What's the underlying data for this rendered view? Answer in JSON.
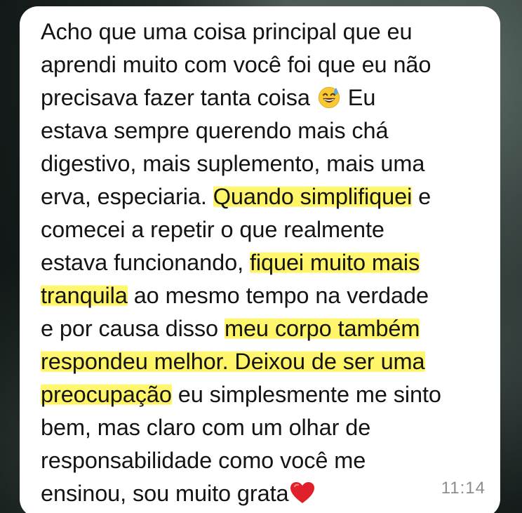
{
  "message": {
    "lines": [
      [
        {
          "text": "Acho que uma coisa principal que eu"
        }
      ],
      [
        {
          "text": "aprendi muito com você foi que eu não"
        }
      ],
      [
        {
          "text": "precisava fazer tanta coisa "
        },
        {
          "emoji": "grinning-sweat-emoji"
        },
        {
          "text": " Eu"
        }
      ],
      [
        {
          "text": "estava sempre querendo mais chá"
        }
      ],
      [
        {
          "text": "digestivo, mais suplemento, mais uma"
        }
      ],
      [
        {
          "text": "erva, especiaria. "
        },
        {
          "text": "Quando simplifiquei",
          "highlight": true
        },
        {
          "text": " e"
        }
      ],
      [
        {
          "text": "comecei a repetir o que realmente"
        }
      ],
      [
        {
          "text": "estava funcionando, "
        },
        {
          "text": "fiquei muito mais",
          "highlight": true
        }
      ],
      [
        {
          "text": "tranquila",
          "highlight": true
        },
        {
          "text": " ao mesmo tempo na verdade"
        }
      ],
      [
        {
          "text": "e por causa disso "
        },
        {
          "text": "meu corpo também",
          "highlight": true
        }
      ],
      [
        {
          "text": "respondeu melhor. Deixou de ser uma",
          "highlight": true
        }
      ],
      [
        {
          "text": "preocupação",
          "highlight": true
        },
        {
          "text": " eu simplesmente me sinto"
        }
      ],
      [
        {
          "text": "bem, mas claro com um olhar de"
        }
      ],
      [
        {
          "text": "responsabilidade como você me"
        }
      ],
      [
        {
          "text": "ensinou, sou muito grata"
        },
        {
          "emoji": "red-heart-emoji"
        }
      ]
    ],
    "timestamp": "11:14"
  },
  "colors": {
    "bubble": "#ffffff",
    "text": "#141414",
    "highlight": "#fff35a",
    "timestamp": "#8d8d8d",
    "heart": "#e0202a",
    "emoji_face": "#f8c934"
  }
}
